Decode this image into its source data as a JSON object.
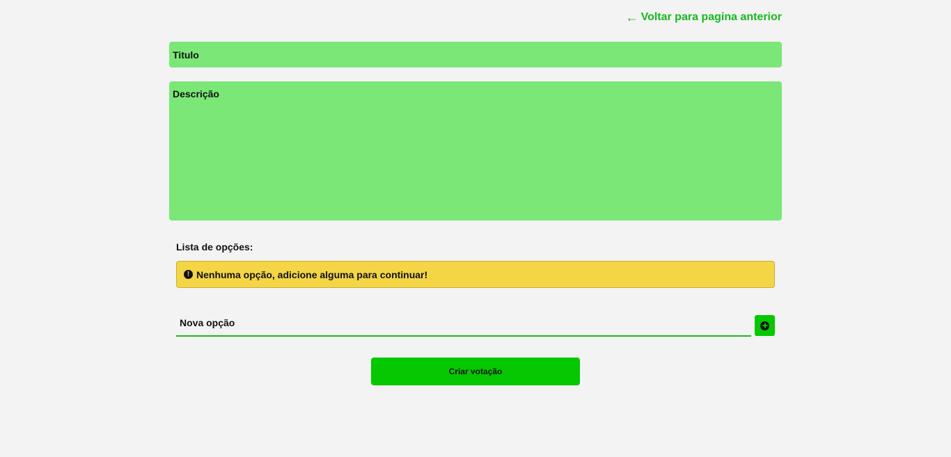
{
  "header": {
    "back_arrow": "🡐",
    "back_label": "Voltar para pagina anterior"
  },
  "form": {
    "title_placeholder": "Titulo",
    "description_placeholder": "Descrição"
  },
  "options": {
    "label": "Lista de opções:",
    "alert_icon": "!",
    "alert_text": "Nenhuma opção, adicione alguma para continuar!",
    "new_option_placeholder": "Nova opção",
    "add_icon": "plus-circle-icon"
  },
  "submit": {
    "label": "Criar votação"
  },
  "colors": {
    "background": "#f3f3f3",
    "accent_green": "#17b91f",
    "input_green": "#7ae777",
    "button_green": "#05c800",
    "alert_yellow": "#f4d545"
  }
}
